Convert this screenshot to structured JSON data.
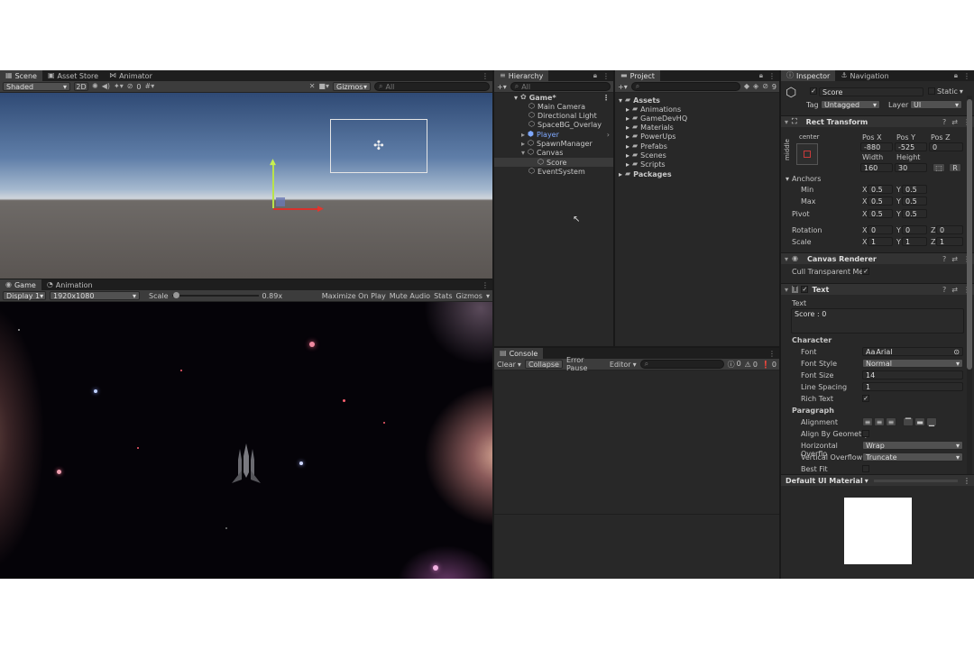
{
  "scene": {
    "tabs": [
      "Scene",
      "Asset Store",
      "Animator"
    ],
    "shading": "Shaded",
    "mode2d": "2D",
    "gizmos": "Gizmos",
    "search_placeholder": "All",
    "hidden_count": "0"
  },
  "game": {
    "tabs": [
      "Game",
      "Animation"
    ],
    "display": "Display 1",
    "resolution": "1920x1080",
    "scale_label": "Scale",
    "scale_value": "0.89x",
    "scale_fraction": 0.02,
    "buttons": [
      "Maximize On Play",
      "Mute Audio",
      "Stats",
      "Gizmos"
    ]
  },
  "hierarchy": {
    "tab": "Hierarchy",
    "search_placeholder": "All",
    "root": "Game*",
    "items": [
      "Main Camera",
      "Directional Light",
      "SpaceBG_Overlay",
      "Player",
      "SpawnManager",
      "Canvas",
      "Score",
      "EventSystem"
    ]
  },
  "project": {
    "tab": "Project",
    "hidden_count": "9",
    "assets_label": "Assets",
    "folders": [
      "Animations",
      "GameDevHQ",
      "Materials",
      "PowerUps",
      "Prefabs",
      "Scenes",
      "Scripts"
    ],
    "packages_label": "Packages"
  },
  "console": {
    "tab": "Console",
    "clear": "Clear",
    "collapse": "Collapse",
    "error_pause": "Error Pause",
    "editor": "Editor",
    "log_count": "0",
    "warn_count": "0",
    "error_count": "0"
  },
  "inspector": {
    "tabs": [
      "Inspector",
      "Navigation"
    ],
    "object_name": "Score",
    "static_label": "Static",
    "tag_label": "Tag",
    "tag_value": "Untagged",
    "layer_label": "Layer",
    "layer_value": "UI",
    "rect_transform": {
      "title": "Rect Transform",
      "anchor_h": "center",
      "anchor_v": "middle",
      "posx_label": "Pos X",
      "posy_label": "Pos Y",
      "posz_label": "Pos Z",
      "posx": "-880",
      "posy": "-525",
      "posz": "0",
      "width_label": "Width",
      "height_label": "Height",
      "width": "160",
      "height": "30",
      "r_label": "R",
      "anchors_label": "Anchors",
      "min_label": "Min",
      "max_label": "Max",
      "pivot_label": "Pivot",
      "rotation_label": "Rotation",
      "scale_label": "Scale",
      "x_label": "X",
      "y_label": "Y",
      "z_label": "Z",
      "min_x": "0.5",
      "min_y": "0.5",
      "max_x": "0.5",
      "max_y": "0.5",
      "pivot_x": "0.5",
      "pivot_y": "0.5",
      "rot_x": "0",
      "rot_y": "0",
      "rot_z": "0",
      "scale_x": "1",
      "scale_y": "1",
      "scale_z": "1"
    },
    "canvas_renderer": {
      "title": "Canvas Renderer",
      "cull_label": "Cull Transparent Mes"
    },
    "text": {
      "title": "Text",
      "text_label": "Text",
      "text_value": "Score : 0",
      "character_label": "Character",
      "font_label": "Font",
      "font_value": "Arial",
      "font_style_label": "Font Style",
      "font_style_value": "Normal",
      "font_size_label": "Font Size",
      "font_size_value": "14",
      "line_spacing_label": "Line Spacing",
      "line_spacing_value": "1",
      "rich_text_label": "Rich Text",
      "paragraph_label": "Paragraph",
      "alignment_label": "Alignment",
      "align_geometry_label": "Align By Geometry",
      "h_overflow_label": "Horizontal Overflo",
      "h_overflow_value": "Wrap",
      "v_overflow_label": "Vertical Overflow",
      "v_overflow_value": "Truncate",
      "best_fit_label": "Best Fit"
    },
    "material_label": "Default UI Material"
  }
}
